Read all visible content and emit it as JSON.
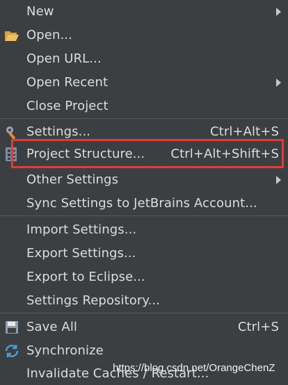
{
  "menu": {
    "new": {
      "label": "New"
    },
    "open": {
      "label": "Open..."
    },
    "open_url": {
      "label": "Open URL..."
    },
    "open_recent": {
      "label": "Open Recent"
    },
    "close_project": {
      "label": "Close Project"
    },
    "settings": {
      "label": "Settings...",
      "shortcut": "Ctrl+Alt+S"
    },
    "project_structure": {
      "label": "Project Structure...",
      "shortcut": "Ctrl+Alt+Shift+S"
    },
    "other_settings": {
      "label": "Other Settings"
    },
    "sync_settings": {
      "label": "Sync Settings to JetBrains Account..."
    },
    "import_settings": {
      "label": "Import Settings..."
    },
    "export_settings": {
      "label": "Export Settings..."
    },
    "export_eclipse": {
      "label": "Export to Eclipse..."
    },
    "settings_repo": {
      "label": "Settings Repository..."
    },
    "save_all": {
      "label": "Save All",
      "shortcut": "Ctrl+S"
    },
    "synchronize": {
      "label": "Synchronize"
    },
    "invalidate": {
      "label": "Invalidate Caches / Restart..."
    }
  },
  "watermark": "https://blog.csdn.net/OrangeChenZ",
  "colors": {
    "background": "#3c3f41",
    "text": "#dcdcdc",
    "highlight": "#e53935",
    "separator": "#555759"
  },
  "icons": [
    "folder-open-icon",
    "wrench-settings-icon",
    "project-structure-icon",
    "save-disk-icon",
    "sync-icon"
  ]
}
